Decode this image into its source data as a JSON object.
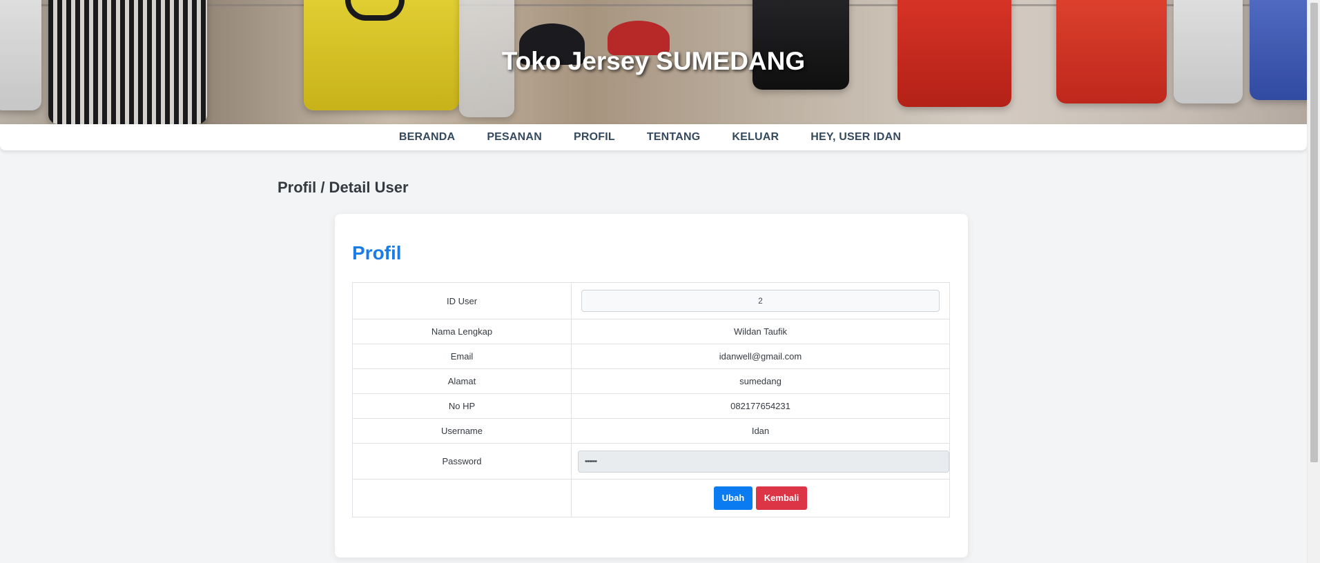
{
  "site": {
    "title": "Toko Jersey SUMEDANG"
  },
  "nav": {
    "items": [
      {
        "label": "BERANDA"
      },
      {
        "label": "PESANAN"
      },
      {
        "label": "PROFIL"
      },
      {
        "label": "TENTANG"
      },
      {
        "label": "KELUAR"
      },
      {
        "label": "HEY, USER IDAN"
      }
    ]
  },
  "page": {
    "heading": "Profil / Detail User"
  },
  "card": {
    "title": "Profil"
  },
  "profile": {
    "rows": [
      {
        "label": "ID User",
        "value": "2"
      },
      {
        "label": "Nama Lengkap",
        "value": "Wildan Taufik"
      },
      {
        "label": "Email",
        "value": "idanwell@gmail.com"
      },
      {
        "label": "Alamat",
        "value": "sumedang"
      },
      {
        "label": "No HP",
        "value": "082177654231"
      },
      {
        "label": "Username",
        "value": "Idan"
      },
      {
        "label": "Password",
        "value": "••••••"
      }
    ]
  },
  "actions": {
    "edit_label": "Ubah",
    "back_label": "Kembali"
  },
  "colors": {
    "title_blue": "#1a7ce6",
    "button_primary": "#0a7bf0",
    "button_danger": "#dc3545",
    "nav_text": "#34495e"
  }
}
